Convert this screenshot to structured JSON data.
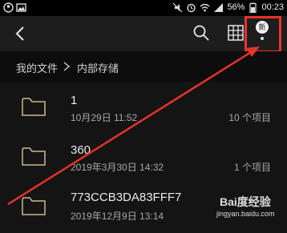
{
  "status_bar": {
    "battery": "56%",
    "time": "00:23"
  },
  "toolbar": {
    "new_badge": "新"
  },
  "breadcrumb": {
    "items": [
      "我的文件",
      "内部存储"
    ]
  },
  "files": [
    {
      "name": "1",
      "date": "10月29日 11:52",
      "count": "10 个项目"
    },
    {
      "name": "360",
      "date": "2019年3月30日 14:32",
      "count": "1 个项目"
    },
    {
      "name": "773CCB3DA83FFF7",
      "date": "2019年12月9日 13:14",
      "count": ""
    }
  ],
  "watermark": {
    "brand": "Bai度经验",
    "url": "jingyan.baidu.com"
  },
  "colors": {
    "highlight": "#e8332b",
    "folder": "#cbb98a",
    "background": "#141414"
  }
}
